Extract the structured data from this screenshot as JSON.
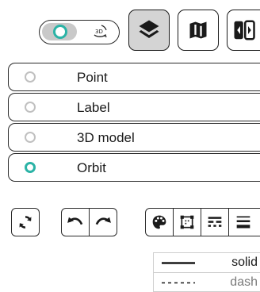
{
  "view_toggle": {
    "selected": "2D",
    "icon_3d_text": "3D"
  },
  "toolbar": {
    "layers_icon": "layers-icon",
    "map_icon": "map-icon",
    "split_icon": "split-view-icon"
  },
  "marker_types": [
    {
      "label": "Point",
      "selected": false
    },
    {
      "label": "Label",
      "selected": false
    },
    {
      "label": "3D model",
      "selected": false
    },
    {
      "label": "Orbit",
      "selected": true
    }
  ],
  "tools": {
    "sync_icon": "sync-icon",
    "undo_icon": "undo-icon",
    "redo_icon": "redo-icon",
    "palette_icon": "palette-icon",
    "select_icon": "select-box-icon",
    "line_style_icon": "line-style-icon",
    "line_width_icon": "line-width-icon"
  },
  "line_styles": [
    {
      "label": "solid"
    },
    {
      "label": "dash"
    }
  ],
  "colors": {
    "accent": "#2bb3a6",
    "border": "#2a2a2a",
    "active_bg": "#d4d4d4"
  }
}
